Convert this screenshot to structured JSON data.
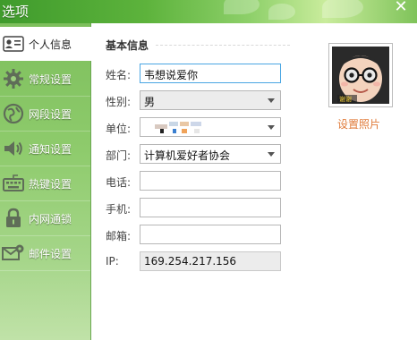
{
  "window": {
    "title": "选项"
  },
  "sidebar": {
    "items": [
      {
        "label": "个人信息",
        "icon": "contact-card-icon",
        "active": true
      },
      {
        "label": "常规设置",
        "icon": "gear-icon",
        "active": false
      },
      {
        "label": "网段设置",
        "icon": "globe-icon",
        "active": false
      },
      {
        "label": "通知设置",
        "icon": "speaker-icon",
        "active": false
      },
      {
        "label": "热键设置",
        "icon": "keyboard-icon",
        "active": false
      },
      {
        "label": "内网通锁",
        "icon": "lock-icon",
        "active": false
      },
      {
        "label": "邮件设置",
        "icon": "mail-settings-icon",
        "active": false
      }
    ]
  },
  "main": {
    "section_title": "基本信息",
    "fields": {
      "name": {
        "label": "姓名:",
        "value": "韦想说爱你"
      },
      "gender": {
        "label": "性别:",
        "value": "男"
      },
      "unit": {
        "label": "单位:",
        "value": ""
      },
      "department": {
        "label": "部门:",
        "value": "计算机爱好者协会"
      },
      "phone": {
        "label": "电话:",
        "value": ""
      },
      "mobile": {
        "label": "手机:",
        "value": ""
      },
      "email": {
        "label": "邮箱:",
        "value": ""
      },
      "ip": {
        "label": "IP:",
        "value": "169.254.217.156"
      }
    },
    "avatar": {
      "link_label": "设置照片",
      "badge_text": "谢谢"
    }
  },
  "colors": {
    "accent_green": "#5db33c",
    "link_orange": "#e07b3a",
    "focus_blue": "#4aa6e3"
  }
}
